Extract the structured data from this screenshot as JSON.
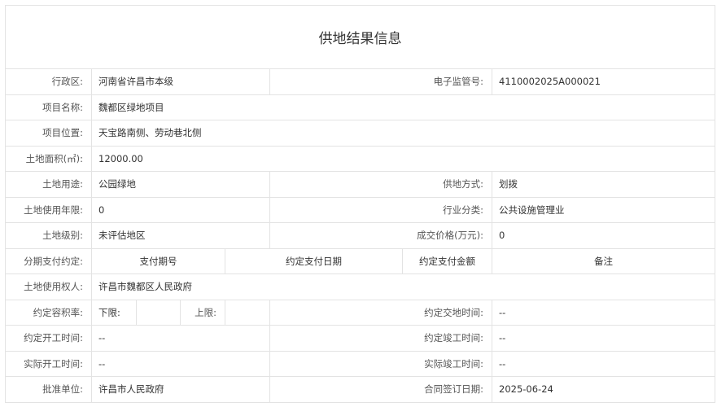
{
  "title": "供地结果信息",
  "rows": {
    "district": {
      "label": "行政区:",
      "value": "河南省许昌市本级"
    },
    "supervision_no": {
      "label": "电子监管号:",
      "value": "4110002025A000021"
    },
    "project_name": {
      "label": "项目名称:",
      "value": "魏都区绿地项目"
    },
    "project_location": {
      "label": "项目位置:",
      "value": "天宝路南侧、劳动巷北侧"
    },
    "land_area": {
      "label": "土地面积(㎡):",
      "value": "12000.00"
    },
    "land_use": {
      "label": "土地用途:",
      "value": "公园绿地"
    },
    "supply_method": {
      "label": "供地方式:",
      "value": "划拨"
    },
    "use_years": {
      "label": "土地使用年限:",
      "value": "0"
    },
    "industry": {
      "label": "行业分类:",
      "value": "公共设施管理业"
    },
    "land_grade": {
      "label": "土地级别:",
      "value": "未评估地区"
    },
    "deal_price": {
      "label": "成交价格(万元):",
      "value": "0"
    },
    "installment": {
      "label": "分期支付约定:",
      "headers": [
        "支付期号",
        "约定支付日期",
        "约定支付金额",
        "备注"
      ]
    },
    "land_user": {
      "label": "土地使用权人:",
      "value": "许昌市魏都区人民政府"
    },
    "plot_ratio": {
      "label": "约定容积率:",
      "lower_label": "下限:",
      "lower_value": "",
      "upper_label": "上限:",
      "upper_value": ""
    },
    "delivery_time": {
      "label": "约定交地时间:",
      "value": "--"
    },
    "start_time_agreed": {
      "label": "约定开工时间:",
      "value": "--"
    },
    "finish_time_agreed": {
      "label": "约定竣工时间:",
      "value": "--"
    },
    "start_time_actual": {
      "label": "实际开工时间:",
      "value": "--"
    },
    "finish_time_actual": {
      "label": "实际竣工时间:",
      "value": "--"
    },
    "approval_unit": {
      "label": "批准单位:",
      "value": "许昌市人民政府"
    },
    "contract_date": {
      "label": "合同签订日期:",
      "value": "2025-06-24"
    }
  }
}
